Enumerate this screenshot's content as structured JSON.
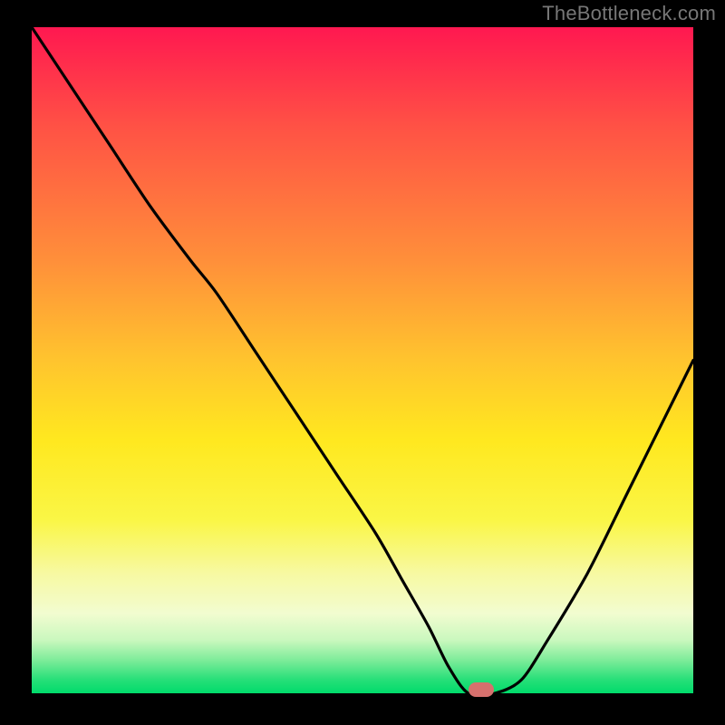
{
  "attribution": "TheBottleneck.com",
  "colors": {
    "frame_bg": "#000000",
    "marker": "#d6706d",
    "curve": "#000000",
    "attribution_text": "#777777"
  },
  "chart_data": {
    "type": "line",
    "title": "",
    "xlabel": "",
    "ylabel": "",
    "xlim": [
      0,
      100
    ],
    "ylim": [
      0,
      100
    ],
    "x": [
      0,
      8,
      12,
      18,
      24,
      28,
      34,
      40,
      46,
      52,
      56,
      60,
      63,
      66,
      70,
      74,
      78,
      84,
      90,
      96,
      100
    ],
    "values": [
      100,
      88,
      82,
      73,
      65,
      60,
      51,
      42,
      33,
      24,
      17,
      10,
      4,
      0,
      0,
      2,
      8,
      18,
      30,
      42,
      50
    ],
    "marker": {
      "x": 68,
      "y": 0
    },
    "gradient_stops": [
      {
        "pos": 0,
        "color": "#ff1850"
      },
      {
        "pos": 15,
        "color": "#ff5245"
      },
      {
        "pos": 35,
        "color": "#ff8f3a"
      },
      {
        "pos": 50,
        "color": "#ffc42e"
      },
      {
        "pos": 62,
        "color": "#ffe81f"
      },
      {
        "pos": 74,
        "color": "#faf646"
      },
      {
        "pos": 82,
        "color": "#f7f9a2"
      },
      {
        "pos": 88,
        "color": "#f2fcd0"
      },
      {
        "pos": 92,
        "color": "#caf8be"
      },
      {
        "pos": 95,
        "color": "#7eec9a"
      },
      {
        "pos": 98,
        "color": "#26df78"
      },
      {
        "pos": 100,
        "color": "#00db6b"
      }
    ]
  }
}
